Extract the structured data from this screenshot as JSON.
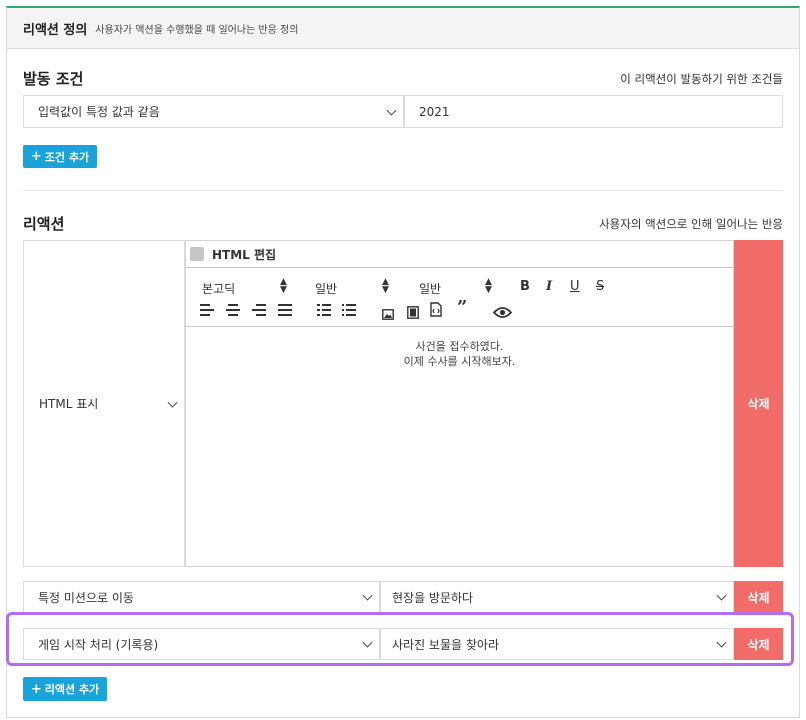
{
  "header": {
    "title": "리액션 정의",
    "subtitle": "사용자가 액션을 수행했을 때 일어나는 반응 정의"
  },
  "trigger": {
    "title": "발동 조건",
    "description": "이 리액션이 발동하기 위한 조건들",
    "condition_select": "입력값이 특정 값과 같음",
    "condition_value": "2021",
    "add_label": "조건 추가"
  },
  "reaction": {
    "title": "리액션",
    "description": "사용자의 액션으로 인해 일어나는 반응",
    "rows": [
      {
        "type": "HTML 표시",
        "html_edit_label": "HTML 편집",
        "editor": {
          "font_select": "본고딕",
          "size_select": "일반",
          "format_select": "일반",
          "content_lines": [
            "사건을 접수하였다.",
            "이제 수사를 시작해보자."
          ]
        },
        "delete_label": "삭제"
      },
      {
        "type": "특정 미션으로 이동",
        "target": "현장을 방문하다",
        "delete_label": "삭제"
      },
      {
        "type": "게임 시작 처리 (기록용)",
        "target": "사라진 보물을 찾아라",
        "delete_label": "삭제"
      }
    ],
    "add_label": "리액션 추가"
  },
  "icons": [
    "plus-icon",
    "chevron-down-icon",
    "bold-icon",
    "italic-icon",
    "underline-icon",
    "strikethrough-icon",
    "align-left-icon",
    "align-center-icon",
    "align-right-icon",
    "align-justify-icon",
    "ordered-list-icon",
    "unordered-list-icon",
    "image-icon",
    "video-icon",
    "file-icon",
    "quote-icon",
    "eye-icon"
  ],
  "colors": {
    "accent_green": "#2fa86a",
    "primary_blue": "#1aa3d9",
    "danger_red": "#f26d6a",
    "highlight_purple": "#b66cf0"
  }
}
